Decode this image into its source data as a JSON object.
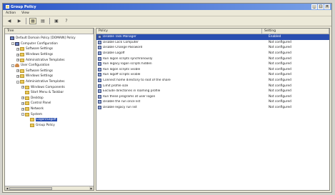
{
  "window": {
    "title": "Group Policy"
  },
  "menu": [
    "Action",
    "View"
  ],
  "left_pane": {
    "header": "Tree",
    "items": [
      {
        "label": "Default Domain Policy [DOMAIN] Policy",
        "indent": 0,
        "icon": "computer-icon",
        "expand": ""
      },
      {
        "label": "Computer Configuration",
        "indent": 1,
        "icon": "computer-icon",
        "expand": "-"
      },
      {
        "label": "Software Settings",
        "indent": 2,
        "icon": "folder-icon",
        "expand": "+"
      },
      {
        "label": "Windows Settings",
        "indent": 2,
        "icon": "folder-icon",
        "expand": "+"
      },
      {
        "label": "Administrative Templates",
        "indent": 2,
        "icon": "folder-icon",
        "expand": "+"
      },
      {
        "label": "User Configuration",
        "indent": 1,
        "icon": "user-icon",
        "expand": "-"
      },
      {
        "label": "Software Settings",
        "indent": 2,
        "icon": "folder-icon",
        "expand": "+"
      },
      {
        "label": "Windows Settings",
        "indent": 2,
        "icon": "folder-icon",
        "expand": "+"
      },
      {
        "label": "Administrative Templates",
        "indent": 2,
        "icon": "folder-icon",
        "expand": "-"
      },
      {
        "label": "Windows Components",
        "indent": 3,
        "icon": "folder-icon",
        "expand": "+"
      },
      {
        "label": "Start Menu & Taskbar",
        "indent": 3,
        "icon": "folder-icon",
        "expand": ""
      },
      {
        "label": "Desktop",
        "indent": 3,
        "icon": "folder-icon",
        "expand": "+"
      },
      {
        "label": "Control Panel",
        "indent": 3,
        "icon": "folder-icon",
        "expand": "+"
      },
      {
        "label": "Network",
        "indent": 3,
        "icon": "folder-icon",
        "expand": "+"
      },
      {
        "label": "System",
        "indent": 3,
        "icon": "folder-icon",
        "expand": "-"
      },
      {
        "label": "Logon/Logoff",
        "indent": 4,
        "icon": "folder-icon",
        "expand": "",
        "selected": true
      },
      {
        "label": "Group Policy",
        "indent": 4,
        "icon": "folder-icon",
        "expand": ""
      }
    ]
  },
  "right_pane": {
    "headers": {
      "policy": "Policy",
      "setting": "Setting"
    },
    "rows": [
      {
        "name": "Disable Task Manager",
        "state": "Enabled",
        "selected": true
      },
      {
        "name": "Disable Lock Computer",
        "state": "Not configured"
      },
      {
        "name": "Disable Change Password",
        "state": "Not configured"
      },
      {
        "name": "Disable Logoff",
        "state": "Not configured"
      },
      {
        "name": "Run logon scripts synchronously",
        "state": "Not configured"
      },
      {
        "name": "Run legacy logon scripts hidden",
        "state": "Not configured"
      },
      {
        "name": "Run logon scripts visible",
        "state": "Not configured"
      },
      {
        "name": "Run logoff scripts visible",
        "state": "Not configured"
      },
      {
        "name": "Connect home directory to root of the share",
        "state": "Not configured"
      },
      {
        "name": "Limit profile size",
        "state": "Not configured"
      },
      {
        "name": "Exclude directories in roaming profile",
        "state": "Not configured"
      },
      {
        "name": "Run these programs at user logon",
        "state": "Not configured"
      },
      {
        "name": "Disable the run once list",
        "state": "Not configured"
      },
      {
        "name": "Disable legacy run list",
        "state": "Not configured"
      }
    ]
  }
}
